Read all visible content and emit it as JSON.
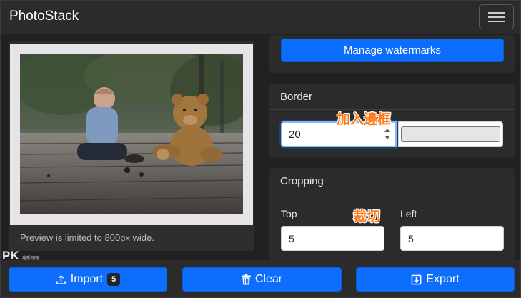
{
  "app": {
    "title": "PhotoStack"
  },
  "preview": {
    "note": "Preview is limited to 800px wide."
  },
  "watermark_badge": {
    "main": "PK",
    "sub": "痞凱踏踏"
  },
  "watermarks_panel": {
    "button_label": "Manage watermarks"
  },
  "border_panel": {
    "title": "Border",
    "width_value": "20",
    "color": "#e6e4e6",
    "annotation": "加入邊框"
  },
  "cropping_panel": {
    "title": "Cropping",
    "annotation": "裁切",
    "fields": [
      {
        "label": "Top",
        "value": "5"
      },
      {
        "label": "Left",
        "value": "5"
      }
    ]
  },
  "bottom_bar": {
    "import_label": "Import",
    "import_count": "5",
    "clear_label": "Clear",
    "export_label": "Export"
  },
  "colors": {
    "primary": "#0d6efd",
    "annotation": "#ff7a1a",
    "panel": "#2b2b2b"
  },
  "icons": {
    "menu": "hamburger-menu-icon",
    "import": "upload-icon",
    "clear": "trash-icon",
    "export": "download-icon"
  }
}
